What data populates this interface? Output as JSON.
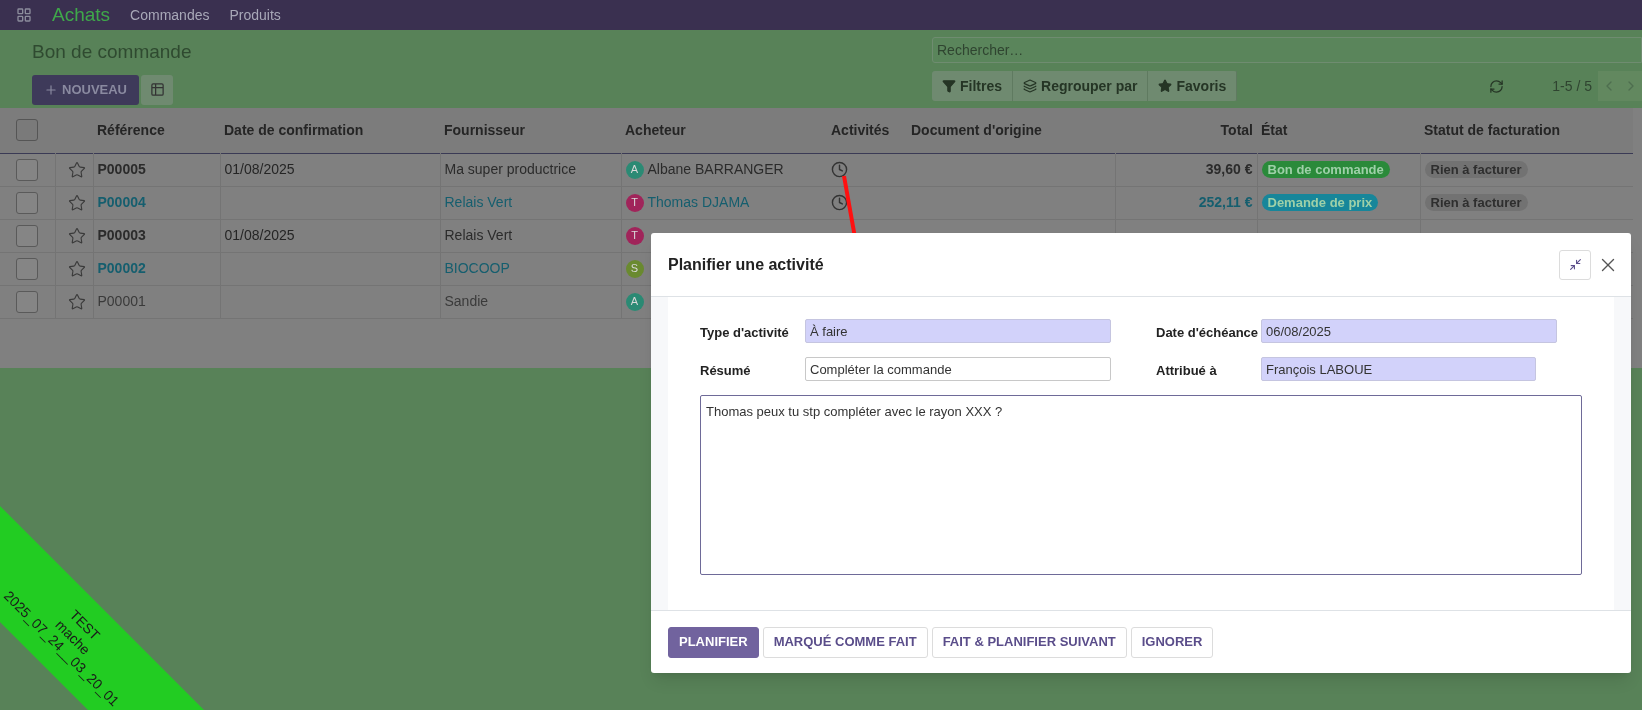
{
  "ribbon": {
    "lines": [
      "TEST",
      "mache",
      "2025_07_24__03_20_01"
    ]
  },
  "navbar": {
    "app": "Achats",
    "menu": [
      "Commandes",
      "Produits"
    ]
  },
  "control_panel": {
    "title": "Bon de commande",
    "new_button": "NOUVEAU",
    "search": {
      "placeholder": "Rechercher…"
    },
    "filters": [
      {
        "label": "Filtres",
        "kind": "filter"
      },
      {
        "label": "Regrouper par",
        "kind": "group"
      },
      {
        "label": "Favoris",
        "kind": "star"
      }
    ],
    "pager": "1-5 / 5"
  },
  "table": {
    "select_all_checked": false,
    "columns": [
      "Référence",
      "Date de confirmation",
      "Fournisseur",
      "Acheteur",
      "Activités",
      "Document d'origine",
      "Total",
      "État",
      "Statut de facturation"
    ],
    "rows": [
      {
        "checked": false,
        "kind": "confirmed",
        "reference": "P00005",
        "date": "01/08/2025",
        "supplier": "Ma super productrice",
        "buyer": {
          "initial": "A",
          "name": "Albane BARRANGER",
          "color": "#2b8a74"
        },
        "activity": true,
        "total": "39,60 €",
        "state": {
          "label": "Bon de commande",
          "color": "#2a8a3a"
        },
        "invoice_status": "Rien à facturer"
      },
      {
        "checked": false,
        "kind": "draft",
        "reference": "P00004",
        "supplier": "Relais Vert",
        "buyer": {
          "initial": "T",
          "name": "Thomas DJAMA",
          "color": "#a0245a"
        },
        "activity": true,
        "total": "252,11 €",
        "state": {
          "label": "Demande de prix",
          "color": "#17869a"
        },
        "invoice_status": "Rien à facturer"
      },
      {
        "checked": false,
        "kind": "confirmed",
        "reference": "P00003",
        "date": "01/08/2025",
        "supplier": "Relais Vert",
        "buyer": {
          "initial": "T",
          "color": "#a0245a"
        },
        "activity": false
      },
      {
        "checked": false,
        "kind": "draft",
        "reference": "P00002",
        "supplier": "BIOCOOP",
        "buyer": {
          "initial": "S",
          "color": "#6a8a30"
        },
        "activity": false
      },
      {
        "checked": false,
        "kind": "cancelled",
        "reference": "P00001",
        "supplier": "Sandie",
        "buyer": {
          "initial": "A",
          "color": "#2b8a74"
        },
        "activity": false
      }
    ]
  },
  "dialog": {
    "title": "Planifier une activité",
    "fields": [
      {
        "label": "Type d'activité",
        "value": "À faire",
        "required": true
      },
      {
        "label": "Date d'échéance",
        "value": "06/08/2025",
        "required": true
      },
      {
        "label": "Résumé",
        "value": "Compléter la commande",
        "required": false
      },
      {
        "label": "Attribué à",
        "value": "François LABOUE",
        "required": true
      }
    ],
    "note": "Thomas peux tu stp compléter avec le rayon XXX ?",
    "buttons": [
      {
        "label": "PLANIFIER",
        "primary": true
      },
      {
        "label": "MARQUÉ COMME FAIT",
        "primary": false
      },
      {
        "label": "FAIT & PLANIFIER SUIVANT",
        "primary": false
      },
      {
        "label": "IGNORER",
        "primary": false
      }
    ]
  }
}
